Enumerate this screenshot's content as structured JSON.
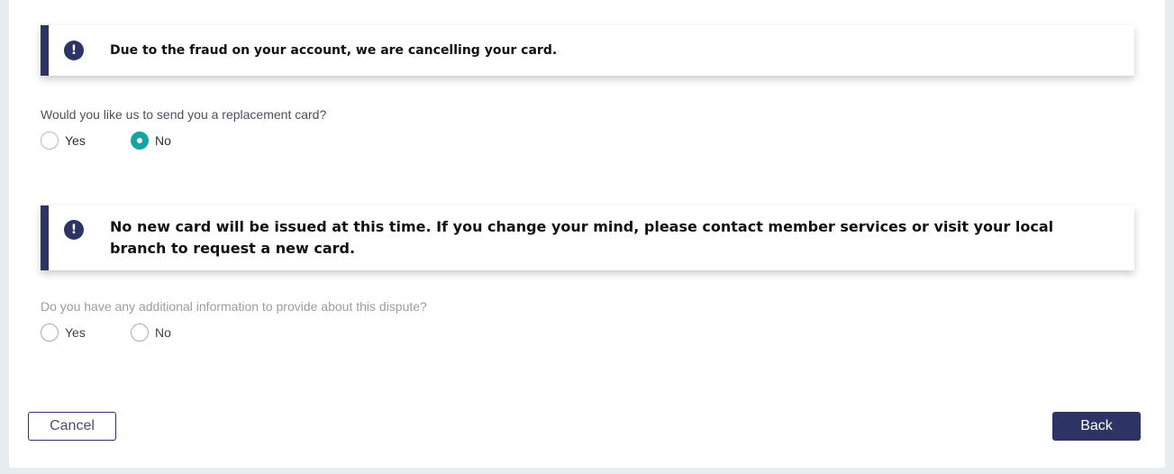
{
  "alerts": [
    {
      "icon": "exclamation-icon",
      "text": "Due to the fraud on your account, we are cancelling your card."
    },
    {
      "icon": "exclamation-icon",
      "text": "No new card will be issued at this time. If you change your mind, please contact member services or visit your local branch to request a new card."
    }
  ],
  "questions": {
    "replacement": {
      "label": "Would you like us to send you a replacement card?",
      "options": [
        "Yes",
        "No"
      ],
      "selected": "No"
    },
    "additional_info": {
      "label": "Do you have any additional information to provide about this dispute?",
      "options": [
        "Yes",
        "No"
      ],
      "selected": null
    }
  },
  "buttons": {
    "cancel": "Cancel",
    "back": "Back"
  },
  "colors": {
    "accent": "#2d3464",
    "radio_selected": "#16a3a3",
    "background": "#e8eef0"
  },
  "icon_glyph": "!"
}
